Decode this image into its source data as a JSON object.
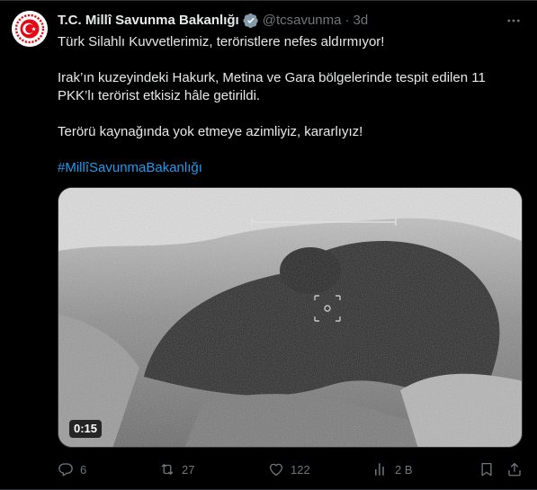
{
  "author": {
    "name": "T.C. Millî Savunma Bakanlığı",
    "handle": "@tcsavunma",
    "separator": "·",
    "time": "3d"
  },
  "tweet": {
    "line1": "Türk Silahlı Kuvvetlerimiz, teröristlere nefes aldırmıyor!",
    "line2": "Irak’ın kuzeyindeki Hakurk, Metina ve Gara bölgelerinde tespit edilen 11 PKK’lı terörist etkisiz hâle getirildi.",
    "line3": "Terörü kaynağında yok etmeye azimliyiz, kararlıyız!",
    "hashtag": "#MillîSavunmaBakanlığı"
  },
  "media": {
    "duration": "0:15"
  },
  "actions": {
    "replies": "6",
    "reposts": "27",
    "likes": "122",
    "views": "2 B"
  },
  "icons": {
    "avatar": "ministry-emblem-icon",
    "verified": "verified-badge-icon",
    "more": "more-options-icon",
    "reply": "reply-icon",
    "repost": "repost-icon",
    "like": "heart-icon",
    "views": "views-icon",
    "bookmark": "bookmark-icon",
    "share": "share-icon"
  },
  "colors": {
    "background": "#000000",
    "text": "#e7e9ea",
    "secondary": "#71767b",
    "link": "#1d9bf0",
    "emblem_red": "#e30a17",
    "verified_gray": "#829aab"
  }
}
